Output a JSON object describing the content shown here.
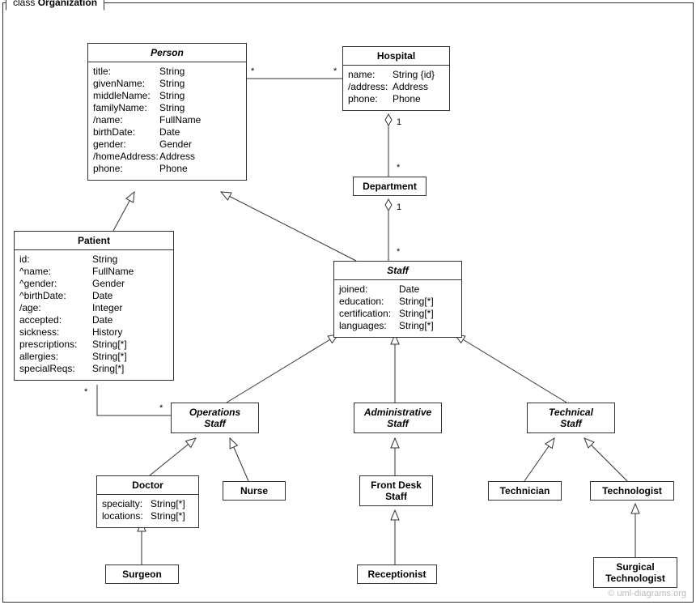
{
  "frame": {
    "title_prefix": "class ",
    "title": "Organization"
  },
  "watermark": "© uml-diagrams.org",
  "classes": {
    "person": {
      "name": "Person",
      "attrs": [
        [
          "title:",
          "String"
        ],
        [
          "givenName:",
          "String"
        ],
        [
          "middleName:",
          "String"
        ],
        [
          "familyName:",
          "String"
        ],
        [
          "/name:",
          "FullName"
        ],
        [
          "birthDate:",
          "Date"
        ],
        [
          "gender:",
          "Gender"
        ],
        [
          "/homeAddress:",
          "Address"
        ],
        [
          "phone:",
          "Phone"
        ]
      ]
    },
    "hospital": {
      "name": "Hospital",
      "attrs": [
        [
          "name:",
          "String {id}"
        ],
        [
          "/address:",
          "Address"
        ],
        [
          "phone:",
          "Phone"
        ]
      ]
    },
    "department": {
      "name": "Department"
    },
    "patient": {
      "name": "Patient",
      "attrs": [
        [
          "id:",
          "String"
        ],
        [
          "^name:",
          "FullName"
        ],
        [
          "^gender:",
          "Gender"
        ],
        [
          "^birthDate:",
          "Date"
        ],
        [
          "/age:",
          "Integer"
        ],
        [
          "accepted:",
          "Date"
        ],
        [
          "sickness:",
          "History"
        ],
        [
          "prescriptions:",
          "String[*]"
        ],
        [
          "allergies:",
          "String[*]"
        ],
        [
          "specialReqs:",
          "Sring[*]"
        ]
      ]
    },
    "staff": {
      "name": "Staff",
      "attrs": [
        [
          "joined:",
          "Date"
        ],
        [
          "education:",
          "String[*]"
        ],
        [
          "certification:",
          "String[*]"
        ],
        [
          "languages:",
          "String[*]"
        ]
      ]
    },
    "operationsStaff": {
      "name_l1": "Operations",
      "name_l2": "Staff"
    },
    "administrativeStaff": {
      "name_l1": "Administrative",
      "name_l2": "Staff"
    },
    "technicalStaff": {
      "name_l1": "Technical",
      "name_l2": "Staff"
    },
    "doctor": {
      "name": "Doctor",
      "attrs": [
        [
          "specialty:",
          "String[*]"
        ],
        [
          "locations:",
          "String[*]"
        ]
      ]
    },
    "nurse": {
      "name": "Nurse"
    },
    "frontDeskStaff": {
      "name_l1": "Front Desk",
      "name_l2": "Staff"
    },
    "receptionist": {
      "name": "Receptionist"
    },
    "technician": {
      "name": "Technician"
    },
    "technologist": {
      "name": "Technologist"
    },
    "surgicalTechnologist": {
      "name_l1": "Surgical",
      "name_l2": "Technologist"
    },
    "surgeon": {
      "name": "Surgeon"
    }
  },
  "mult": {
    "person_hosp_l": "*",
    "person_hosp_r": "*",
    "hosp_dept_top": "1",
    "hosp_dept_bot": "*",
    "dept_staff_top": "1",
    "dept_staff_bot": "*",
    "patient_ops_l": "*",
    "patient_ops_r": "*"
  }
}
